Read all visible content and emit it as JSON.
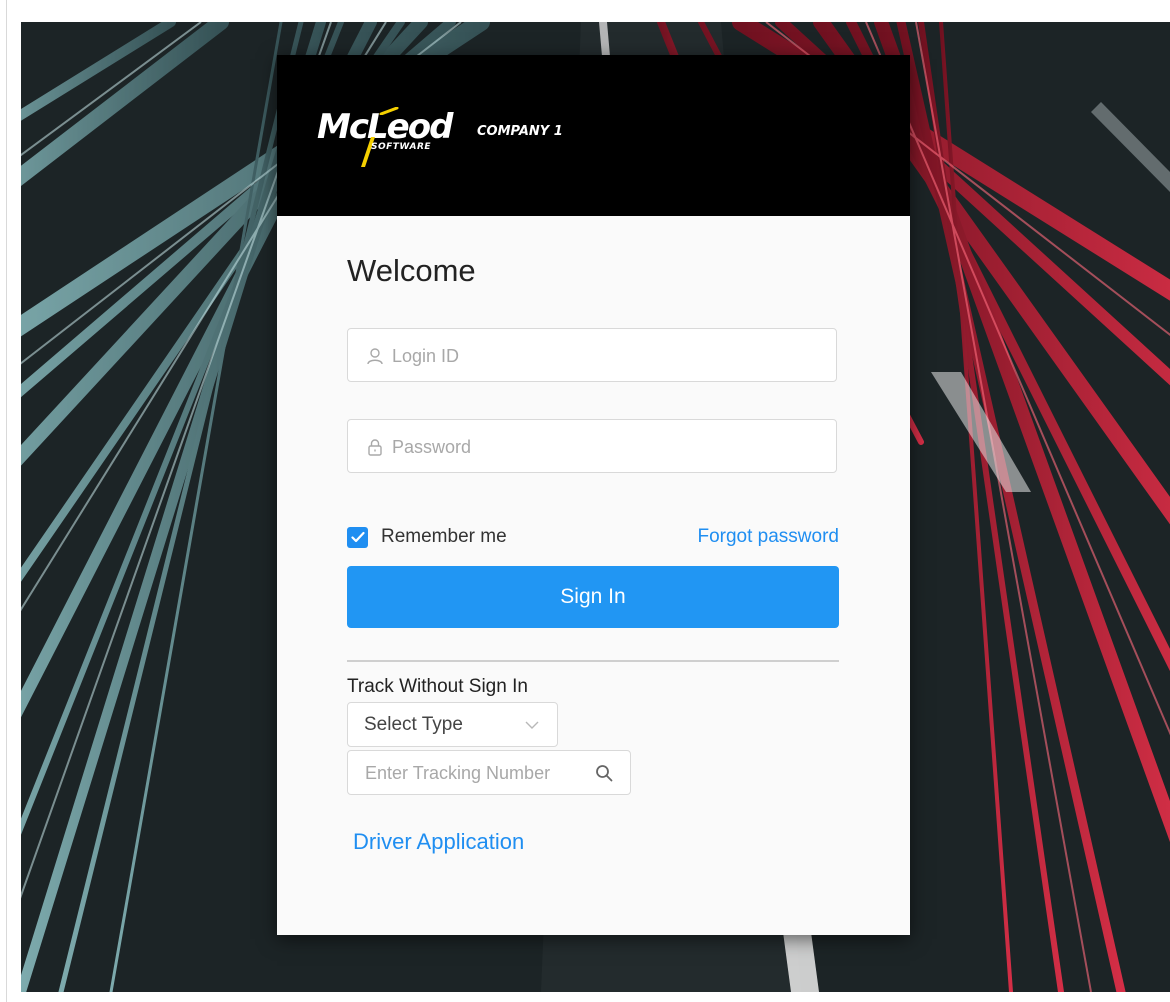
{
  "brand": {
    "logo_word": "McLeod",
    "logo_subword": "SOFTWARE",
    "company": "COMPANY 1",
    "logo_accent_color": "#f5d000"
  },
  "login": {
    "title": "Welcome",
    "login_id_placeholder": "Login ID",
    "login_id_icon": "user-icon",
    "password_placeholder": "Password",
    "password_icon": "lock-icon",
    "remember_label": "Remember me",
    "remember_checked": true,
    "forgot_label": "Forgot password",
    "signin_label": "Sign In"
  },
  "tracking": {
    "title": "Track Without Sign In",
    "select_value": "Select Type",
    "tracking_placeholder": "Enter Tracking Number",
    "search_icon": "search-icon"
  },
  "driver_application_label": "Driver Application",
  "colors": {
    "accent": "#2196f3",
    "link": "#1f8ef1",
    "header_bg": "#000000"
  }
}
